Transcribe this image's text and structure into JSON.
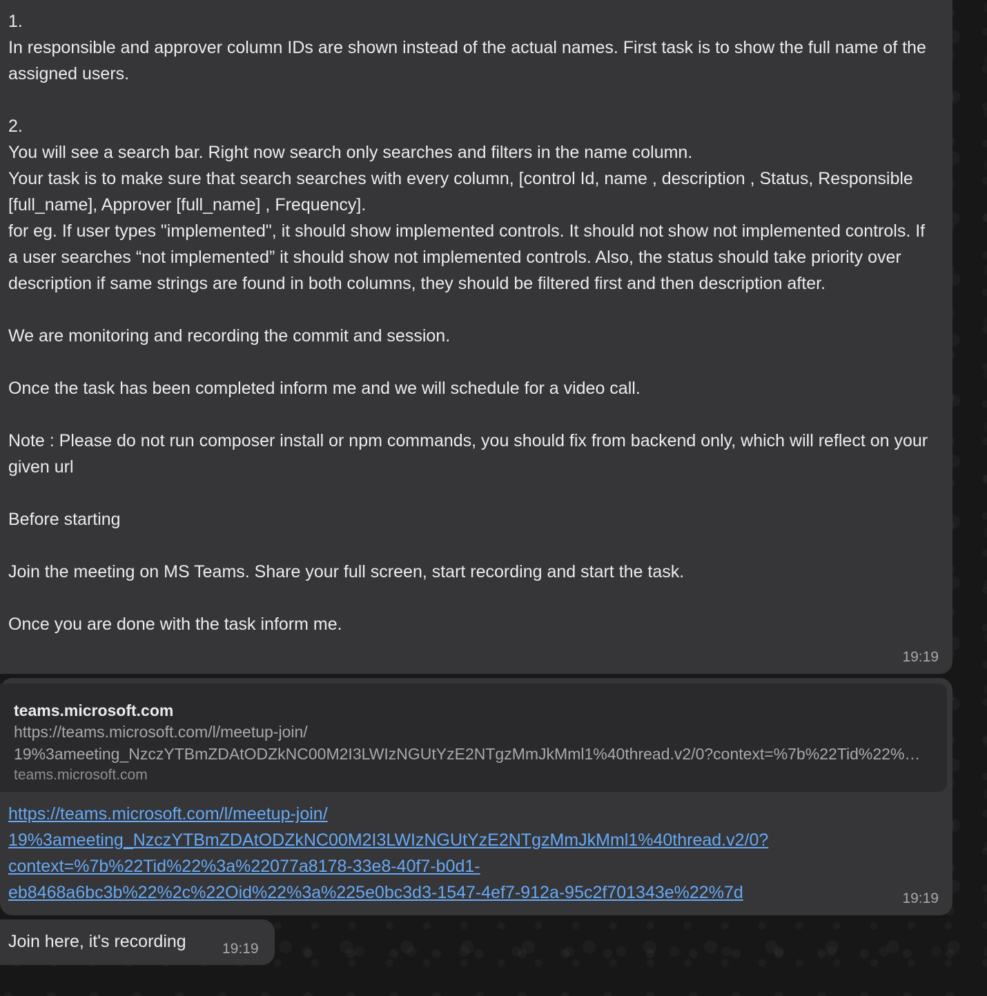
{
  "messages": [
    {
      "text": "1.\nIn responsible and approver column IDs are shown instead of the actual names. First task is to show the full name of the assigned users.\n\n2.\nYou will see a search bar. Right now search only searches and filters in the name column.\nYour task is to make sure that search searches with every column, [control Id, name , description , Status, Responsible [full_name], Approver [full_name] , Frequency].\nfor eg. If user types \"implemented\", it should show implemented controls. It should not show not implemented controls. If a user searches “not implemented” it should show not implemented controls. Also, the status should take priority over description if same strings are found in both columns, they should be filtered first and then description after.\n\nWe are monitoring and recording the commit and session.\n\nOnce the task has been completed inform me and we will schedule for a video call.\n\nNote : Please do not run composer install or npm commands, you should fix from backend only, which will reflect on your given url\n\nBefore starting\n\nJoin the meeting on MS Teams. Share your full screen, start recording and start the task.\n\nOnce you are done with the task inform me.",
      "time": "19:19"
    },
    {
      "preview": {
        "title": "teams.microsoft.com",
        "url_line1": "https://teams.microsoft.com/l/meetup-join/",
        "url_line2": "19%3ameeting_NzczYTBmZDAtODZkNC00M2I3LWIzNGUtYzE2NTgzMmJkMml1%40thread.v2/0?context=%7b%22Tid%22%3a%22077a8178-33e8-40f7-b0d1-eb8468a6bc3b%22%2c%22Oid%22%3a%225e0bc3d3-1547-4ef7-912a-95c2f701343e%22%7d",
        "domain": "teams.microsoft.com"
      },
      "link": "https://teams.microsoft.com/l/meetup-join/\n19%3ameeting_NzczYTBmZDAtODZkNC00M2I3LWIzNGUtYzE2NTgzMmJkMml1%40thread.v2/0?\ncontext=%7b%22Tid%22%3a%22077a8178-33e8-40f7-b0d1-\neb8468a6bc3b%22%2c%22Oid%22%3a%225e0bc3d3-1547-4ef7-912a-95c2f701343e%22%7d",
      "time": "19:19"
    },
    {
      "text": "Join here, it's recording",
      "time": "19:19"
    }
  ]
}
